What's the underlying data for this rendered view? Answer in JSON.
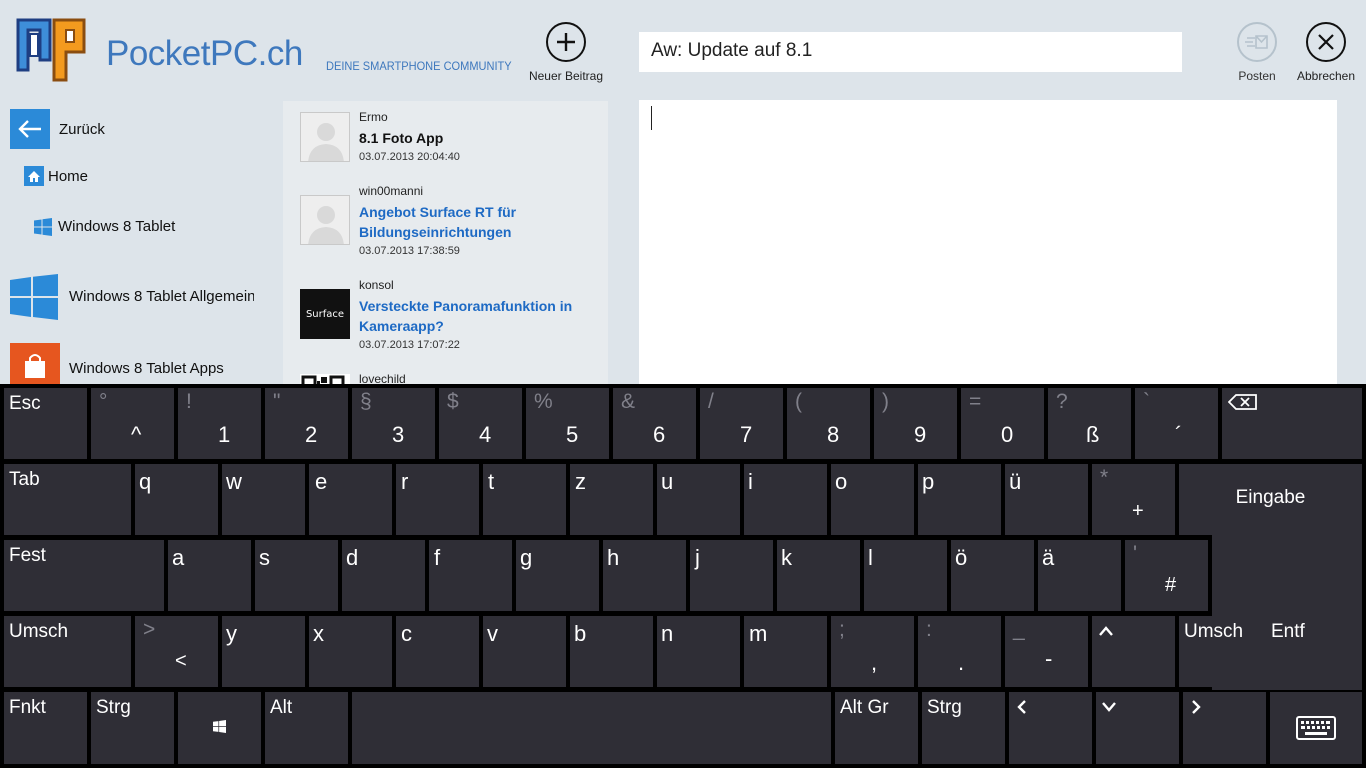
{
  "header": {
    "brand": "PocketPC.ch",
    "tagline": "DEINE SMARTPHONE COMMUNITY",
    "new_post_label": "Neuer Beitrag",
    "subject_value": "Aw: Update auf 8.1",
    "post_label": "Posten",
    "cancel_label": "Abbrechen"
  },
  "nav": {
    "back_label": "Zurück",
    "home_label": "Home",
    "section_label": "Windows 8 Tablet",
    "forum1_label": "Windows 8 Tablet Allgemein",
    "forum2_label": "Windows 8 Tablet Apps"
  },
  "threads": [
    {
      "user": "Ermo",
      "title": "8.1 Foto App",
      "date": "03.07.2013 20:04:40",
      "read": true,
      "avatar": "default-avatar"
    },
    {
      "user": "win00manni",
      "title": "Angebot Surface RT für Bildungseinrichtungen",
      "date": "03.07.2013 17:38:59",
      "read": false,
      "avatar": "default-avatar"
    },
    {
      "user": "konsol",
      "title": "Versteckte Panoramafunktion in Kameraapp?",
      "date": "03.07.2013 17:07:22",
      "read": false,
      "avatar": "Surface"
    },
    {
      "user": "lovechild",
      "title": "",
      "date": "",
      "read": false,
      "avatar": "qr-code-avatar"
    }
  ],
  "keyboard": {
    "row1": [
      {
        "sec": "",
        "main": "Esc"
      },
      {
        "sec": "°",
        "main": "^"
      },
      {
        "sec": "!",
        "main": "1"
      },
      {
        "sec": "\"",
        "main": "2"
      },
      {
        "sec": "§",
        "main": "3"
      },
      {
        "sec": "$",
        "main": "4"
      },
      {
        "sec": "%",
        "main": "5"
      },
      {
        "sec": "&",
        "main": "6"
      },
      {
        "sec": "/",
        "main": "7"
      },
      {
        "sec": "(",
        "main": "8"
      },
      {
        "sec": ")",
        "main": "9"
      },
      {
        "sec": "=",
        "main": "0"
      },
      {
        "sec": "?",
        "main": "ß"
      },
      {
        "sec": "`",
        "main": "´"
      }
    ],
    "row2": [
      "Tab",
      "q",
      "w",
      "e",
      "r",
      "t",
      "z",
      "u",
      "i",
      "o",
      "p",
      "ü"
    ],
    "row2_plus": {
      "sec": "*",
      "main": "+"
    },
    "enter_label": "Eingabe",
    "row3": [
      "Fest",
      "a",
      "s",
      "d",
      "f",
      "g",
      "h",
      "j",
      "k",
      "l",
      "ö",
      "ä"
    ],
    "row3_hash": {
      "sec": "'",
      "main": "#"
    },
    "row4_left": "Umsch",
    "row4_lt": {
      "sec": ">",
      "main": "<"
    },
    "row4": [
      "y",
      "x",
      "c",
      "v",
      "b",
      "n",
      "m"
    ],
    "row4_punct": [
      {
        "sec": ";",
        "main": ","
      },
      {
        "sec": ":",
        "main": "."
      },
      {
        "sec": "_",
        "main": "-"
      }
    ],
    "row4_right": [
      "Umsch",
      "Entf"
    ],
    "row5_left": [
      "Fnkt",
      "Strg"
    ],
    "alt_label": "Alt",
    "altgr_label": "Alt Gr",
    "strg_right_label": "Strg"
  },
  "colors": {
    "accent": "#2b8ad8",
    "link": "#1e6ac4",
    "key_bg": "#2f2e36",
    "keyboard_bg": "#000000"
  }
}
